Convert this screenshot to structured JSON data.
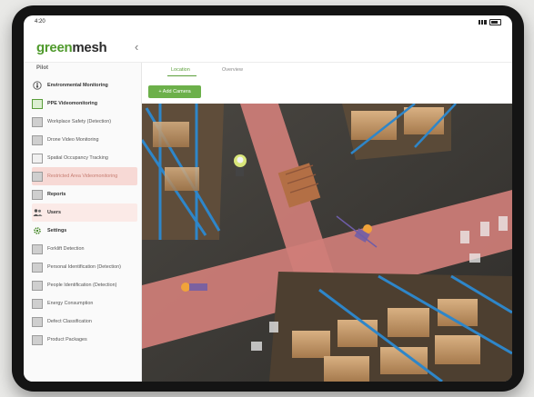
{
  "status_bar": {
    "time": "4:20"
  },
  "brand": {
    "part1": "green",
    "part2": "mesh",
    "primary_color": "#4f9a2c",
    "text_color": "#2b2b2b"
  },
  "header": {
    "collapse_glyph": "‹"
  },
  "sidebar": {
    "heading": "Pilot",
    "items": [
      {
        "label": "Environmental Monitoring",
        "icon": "thermometer-icon",
        "style": "bold"
      },
      {
        "label": "PPE Videomonitoring",
        "icon": "camera-box-icon",
        "style": "bold"
      },
      {
        "label": "Workplace Safety (Detection)",
        "icon": "thumbnail-icon"
      },
      {
        "label": "Drone Video Monitoring",
        "icon": "thumbnail-icon"
      },
      {
        "label": "Spatial Occupancy Tracking",
        "icon": "thumbnail-light-icon"
      },
      {
        "label": "Restricted Area Videomonitoring",
        "icon": "thumbnail-icon",
        "state": "active"
      },
      {
        "label": "Reports",
        "icon": "report-icon",
        "style": "bold"
      },
      {
        "label": "Users",
        "icon": "users-icon",
        "style": "bold",
        "state": "hover"
      },
      {
        "label": "Settings",
        "icon": "gear-icon",
        "style": "bold"
      },
      {
        "label": "Forklift Detection",
        "icon": "thumbnail-icon"
      },
      {
        "label": "Personal Identification (Detection)",
        "icon": "thumbnail-icon"
      },
      {
        "label": "People Identification (Detection)",
        "icon": "thumbnail-icon"
      },
      {
        "label": "Energy Consumption",
        "icon": "thumbnail-icon"
      },
      {
        "label": "Defect Classification",
        "icon": "thumbnail-icon"
      },
      {
        "label": "Product Packages",
        "icon": "thumbnail-icon"
      }
    ]
  },
  "main": {
    "tabs": [
      {
        "label": "Location",
        "active": true
      },
      {
        "label": "Overview",
        "active": false
      }
    ],
    "add_button": "+ Add Camera",
    "accent_color": "#6cb04a"
  }
}
